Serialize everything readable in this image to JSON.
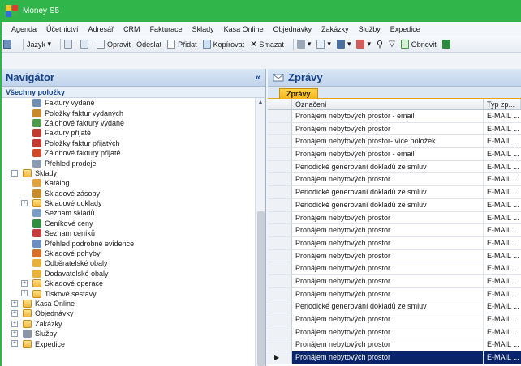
{
  "window": {
    "title": "Money S5"
  },
  "menu": [
    "Agenda",
    "Účetnictví",
    "Adresář",
    "CRM",
    "Fakturace",
    "Sklady",
    "Kasa Online",
    "Objednávky",
    "Zakázky",
    "Služby",
    "Expedice"
  ],
  "toolbar": {
    "language": "Jazyk",
    "edit": "Opravit",
    "send": "Odeslat",
    "add": "Přidat",
    "copy": "Kopírovat",
    "delete": "Smazat",
    "refresh": "Obnovit"
  },
  "navigator": {
    "title": "Navigátor",
    "collapse_glyph": "«",
    "subtitle": "Všechny položky",
    "items": [
      {
        "label": "Faktury vydané",
        "level": 2,
        "color": "#6f8fb5"
      },
      {
        "label": "Položky faktur vydaných",
        "level": 2,
        "color": "#c8892b"
      },
      {
        "label": "Zálohové faktury vydané",
        "level": 2,
        "color": "#4f9a4a"
      },
      {
        "label": "Faktury přijaté",
        "level": 2,
        "color": "#c23b2e"
      },
      {
        "label": "Položky faktur přijatých",
        "level": 2,
        "color": "#c23b2e"
      },
      {
        "label": "Zálohové faktury přijaté",
        "level": 2,
        "color": "#d04a2a"
      },
      {
        "label": "Přehled prodeje",
        "level": 2,
        "color": "#8a9bb0"
      },
      {
        "label": "Sklady",
        "level": 1,
        "folder": true,
        "expander": "−"
      },
      {
        "label": "Katalog",
        "level": 2,
        "color": "#e0a23a"
      },
      {
        "label": "Skladové zásoby",
        "level": 2,
        "color": "#c98a2a"
      },
      {
        "label": "Skladové doklady",
        "level": 2,
        "folder": true,
        "expander": "+"
      },
      {
        "label": "Seznam skladů",
        "level": 2,
        "color": "#7aa0c8"
      },
      {
        "label": "Ceníkové ceny",
        "level": 2,
        "color": "#2f8f3f"
      },
      {
        "label": "Seznam ceníků",
        "level": 2,
        "color": "#cc3b3b"
      },
      {
        "label": "Přehled podrobné evidence",
        "level": 2,
        "color": "#6b8fc2"
      },
      {
        "label": "Skladové pohyby",
        "level": 2,
        "color": "#d9702a"
      },
      {
        "label": "Odběratelské obaly",
        "level": 2,
        "color": "#e6b23a"
      },
      {
        "label": "Dodavatelské obaly",
        "level": 2,
        "color": "#e6b23a"
      },
      {
        "label": "Skladové operace",
        "level": 2,
        "folder": true,
        "expander": "+"
      },
      {
        "label": "Tiskové sestavy",
        "level": 2,
        "folder": true,
        "expander": "+"
      },
      {
        "label": "Kasa Online",
        "level": 1,
        "folder": true,
        "expander": "+"
      },
      {
        "label": "Objednávky",
        "level": 1,
        "folder": true,
        "expander": "+"
      },
      {
        "label": "Zakázky",
        "level": 1,
        "folder": true,
        "expander": "+"
      },
      {
        "label": "Služby",
        "level": 1,
        "color": "#8a96a6",
        "expander": "+"
      },
      {
        "label": "Expedice",
        "level": 1,
        "folder": true,
        "expander": "+"
      }
    ]
  },
  "messages": {
    "title": "Zprávy",
    "tab": "Zprávy",
    "columns": [
      "Označení",
      "Typ zp..."
    ],
    "rows": [
      {
        "name": "Pronájem nebytových prostor - email",
        "type": "E-MAIL ..."
      },
      {
        "name": "Pronájem nebytových prostor",
        "type": "E-MAIL ..."
      },
      {
        "name": "Pronájem nebytových prostor- více položek",
        "type": "E-MAIL ..."
      },
      {
        "name": "Pronájem nebytových prostor - email",
        "type": "E-MAIL ..."
      },
      {
        "name": "Periodické generování dokladů ze smluv",
        "type": "E-MAIL ..."
      },
      {
        "name": "Pronájem nebytových prostor",
        "type": "E-MAIL ..."
      },
      {
        "name": "Periodické generování dokladů ze smluv",
        "type": "E-MAIL ..."
      },
      {
        "name": "Periodické generování dokladů ze smluv",
        "type": "E-MAIL ..."
      },
      {
        "name": "Pronájem nebytových prostor",
        "type": "E-MAIL ..."
      },
      {
        "name": "Pronájem nebytových prostor",
        "type": "E-MAIL ..."
      },
      {
        "name": "Pronájem nebytových prostor",
        "type": "E-MAIL ..."
      },
      {
        "name": "Pronájem nebytových prostor",
        "type": "E-MAIL ..."
      },
      {
        "name": "Pronájem nebytových prostor",
        "type": "E-MAIL ..."
      },
      {
        "name": "Pronájem nebytových prostor",
        "type": "E-MAIL ..."
      },
      {
        "name": "Pronájem nebytových prostor",
        "type": "E-MAIL ..."
      },
      {
        "name": "Periodické generování dokladů ze smluv",
        "type": "E-MAIL ..."
      },
      {
        "name": "Pronájem nebytových prostor",
        "type": "E-MAIL ..."
      },
      {
        "name": "Pronájem nebytových prostor",
        "type": "E-MAIL ..."
      },
      {
        "name": "Pronájem nebytových prostor",
        "type": "E-MAIL ..."
      },
      {
        "name": "Pronájem nebytových prostor",
        "type": "E-MAIL ...",
        "selected": true
      }
    ],
    "selected_marker": "▶"
  },
  "colors": {
    "chrome": "#2fb54a",
    "header_text": "#15428b",
    "selection": "#0a246a",
    "tab": "#f5b21a"
  }
}
